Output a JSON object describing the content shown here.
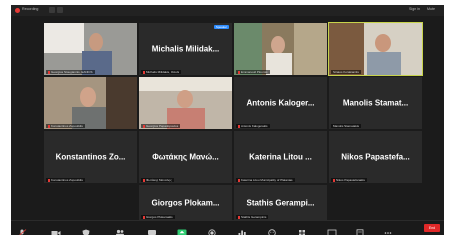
{
  "topbar": {
    "recording_label": "Recording",
    "right_label_1": "Sign in",
    "right_label_2": "Mute"
  },
  "tiles": [
    {
      "name": "",
      "label": "Georgios Stougiannis, EANICS",
      "video": true
    },
    {
      "name": "Michalis Milidak...",
      "label": "Michalis Milidakis, OAuG",
      "video": false,
      "badge": "Speaker"
    },
    {
      "name": "",
      "label": "Emmanouil Ploumis",
      "video": true
    },
    {
      "name": "",
      "label": "Stratos Korakianitis",
      "video": true,
      "highlight": true
    },
    {
      "name": "",
      "label": "Konstantinos Zopoulidis",
      "video": true
    },
    {
      "name": "",
      "label": "Georgios Papadopoulos",
      "video": true
    },
    {
      "name": "Antonis Kaloger...",
      "label": "Antonis Kalogerakis",
      "video": false
    },
    {
      "name": "Manolis Stamat...",
      "label": "Manolis Stamatakis",
      "video": false
    },
    {
      "name": "Konstantinos Zo...",
      "label": "Konstantinos Zopoulidis",
      "video": false
    },
    {
      "name": "Φωτάκης Μανώ...",
      "label": "Φωτάκης Μανώλης",
      "video": false
    },
    {
      "name": "Katerina Litou ...",
      "label": "Katerina Litou Municipality of Platanias",
      "video": false
    },
    {
      "name": "Nikos Papastefa...",
      "label": "Nikos Papastefanakis",
      "video": false
    },
    {
      "name": "Giorgos Plokam...",
      "label": "Giorgos Plokamakis",
      "video": false
    },
    {
      "name": "Stathis Gerampi...",
      "label": "Stathis Gerampinis",
      "video": false
    }
  ],
  "toolbar": {
    "end_label": "End"
  },
  "colors": {
    "tile_bg": "#2a2a2a",
    "highlight": "#c7d34b",
    "end": "#e02828",
    "badge": "#2d8cff"
  }
}
